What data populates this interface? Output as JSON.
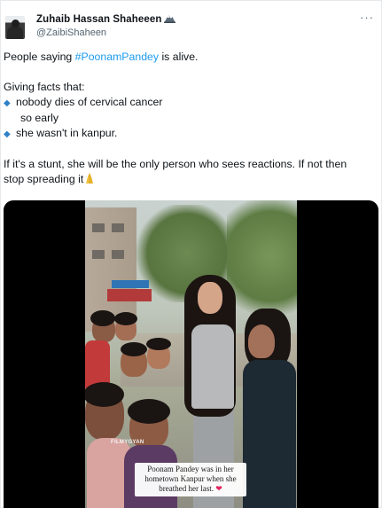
{
  "author": {
    "display_name": "Zuhaib Hassan Shaheeen",
    "handle": "@ZaibiShaheen",
    "badge_icon": "mountain-emoji-icon"
  },
  "more_menu": {
    "icon": "more-horizontal-icon",
    "label": "···"
  },
  "tweet": {
    "line1_prefix": "People saying ",
    "line1_hashtag": "#PoonamPandey",
    "line1_suffix": " is alive.",
    "line2": "Giving facts that:",
    "bullet1_line1": "nobody dies of cervical cancer",
    "bullet1_line2": "so early",
    "bullet2": "she wasn't in kanpur.",
    "line3": "If it's a stunt, she will be the only person who sees reactions. If not then",
    "line4": "stop spreading it",
    "end_emoji": "folded-hands-icon",
    "hashtag_color": "#1d9bf0",
    "bullet_icon": "small-blue-diamond-icon",
    "bullet_glyph": "◆"
  },
  "media": {
    "watermark": "FILMYGYAN",
    "caption_line1": "Poonam Pandey was in her",
    "caption_line2": "hometown Kanpur when she",
    "caption_line3": "breathed her last.",
    "caption_heart": "❤"
  }
}
